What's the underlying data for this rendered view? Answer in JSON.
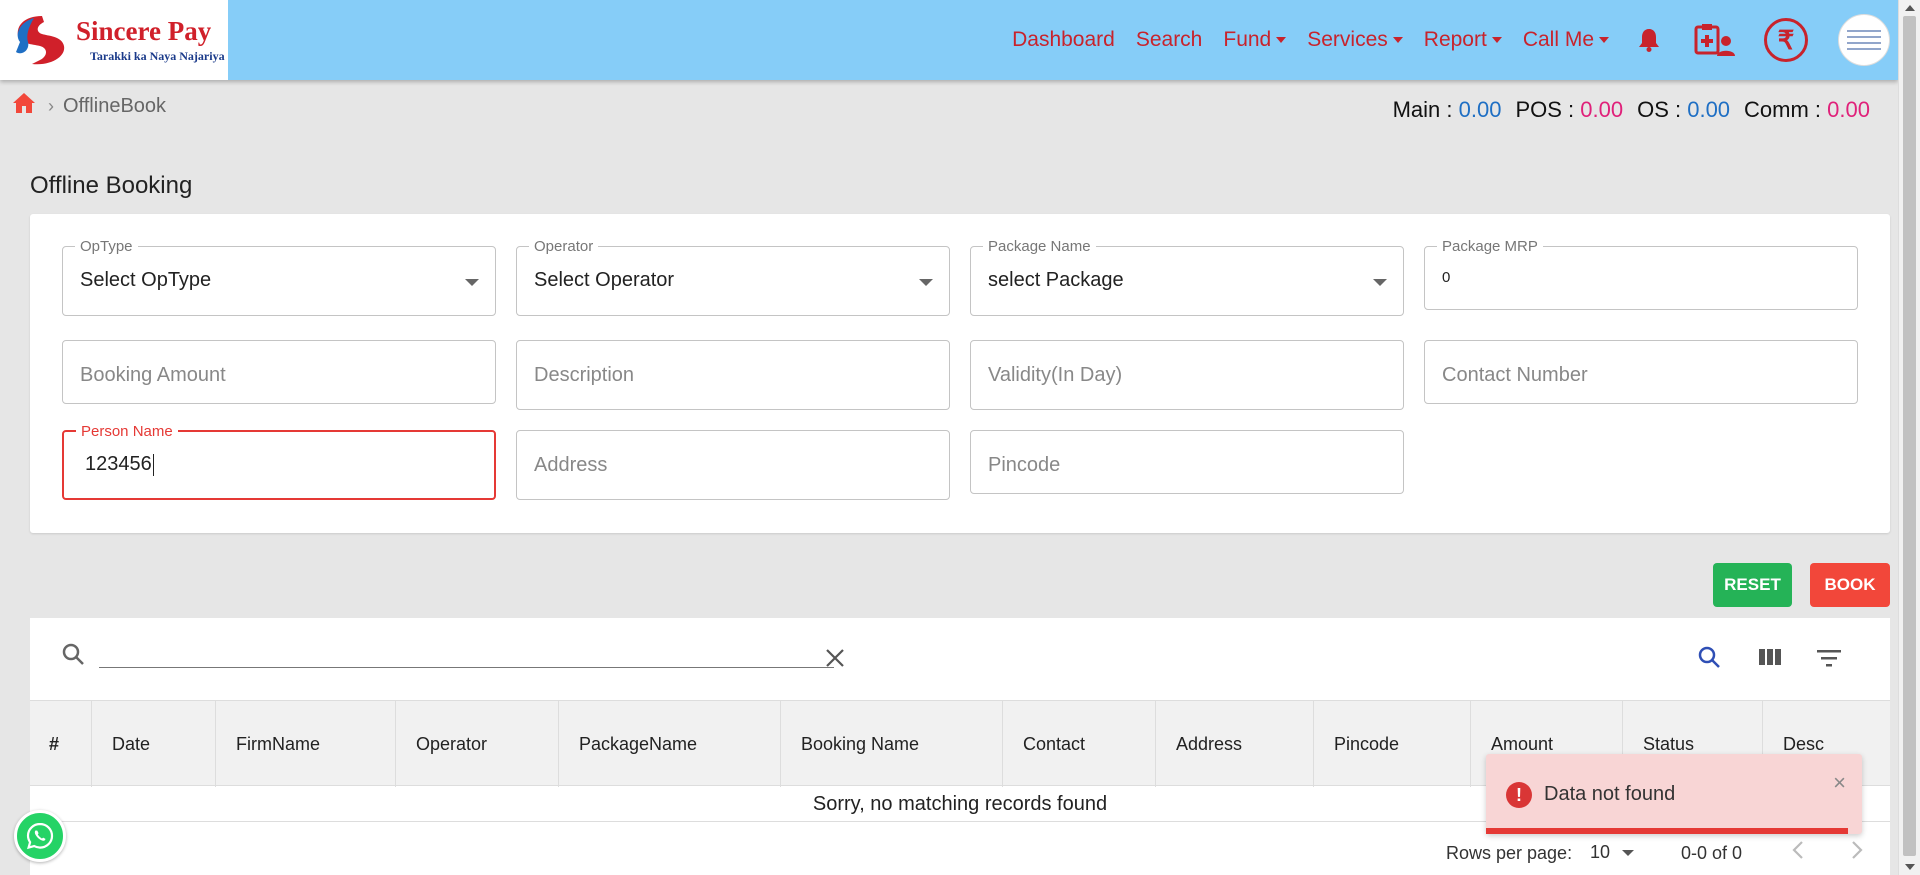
{
  "header": {
    "brand": "Sincere Pay",
    "tagline": "Tarakki ka Naya Najariya",
    "nav": [
      {
        "label": "Dashboard",
        "dropdown": false
      },
      {
        "label": "Search",
        "dropdown": false
      },
      {
        "label": "Fund",
        "dropdown": true
      },
      {
        "label": "Services",
        "dropdown": true
      },
      {
        "label": "Report",
        "dropdown": true
      },
      {
        "label": "Call Me",
        "dropdown": true
      }
    ],
    "icons": [
      "bell-icon",
      "user-medical-icon",
      "rupee-icon",
      "avatar"
    ],
    "rupee_symbol": "₹"
  },
  "breadcrumb": {
    "home_icon": "home-icon",
    "separator": "›",
    "current": "OfflineBook"
  },
  "balances": {
    "main_label": "Main :",
    "main_value": "0.00",
    "pos_label": "POS :",
    "pos_value": "0.00",
    "os_label": "OS :",
    "os_value": "0.00",
    "comm_label": "Comm :",
    "comm_value": "0.00"
  },
  "page_title": "Offline Booking",
  "form": {
    "optype": {
      "label": "OpType",
      "value": "Select OpType"
    },
    "operator": {
      "label": "Operator",
      "value": "Select Operator"
    },
    "package_name": {
      "label": "Package Name",
      "value": "select Package"
    },
    "package_mrp": {
      "label": "Package MRP",
      "value": "0"
    },
    "booking_amount": {
      "placeholder": "Booking Amount"
    },
    "description": {
      "placeholder": "Description"
    },
    "validity": {
      "placeholder": "Validity(In Day)"
    },
    "contact_number": {
      "placeholder": "Contact Number"
    },
    "person_name": {
      "label": "Person Name",
      "value": "123456"
    },
    "address": {
      "placeholder": "Address"
    },
    "pincode": {
      "placeholder": "Pincode"
    }
  },
  "buttons": {
    "reset": "RESET",
    "book": "BOOK"
  },
  "table": {
    "search_value": "",
    "columns": [
      "#",
      "Date",
      "FirmName",
      "Operator",
      "PackageName",
      "Booking Name",
      "Contact",
      "Address",
      "Pincode",
      "Amount",
      "Status",
      "Desc"
    ],
    "empty_message": "Sorry, no matching records found",
    "rows_per_page_label": "Rows per page:",
    "rows_per_page_value": "10",
    "range": "0-0 of 0"
  },
  "toast": {
    "message": "Data not found",
    "close": "×",
    "icon": "!"
  },
  "colors": {
    "header_bg": "#86cdf8",
    "brand_red": "#c8232c",
    "reset_green": "#25b357",
    "book_red": "#f2473a",
    "value_blue": "#1f6fc4",
    "value_pink": "#e0217a"
  }
}
